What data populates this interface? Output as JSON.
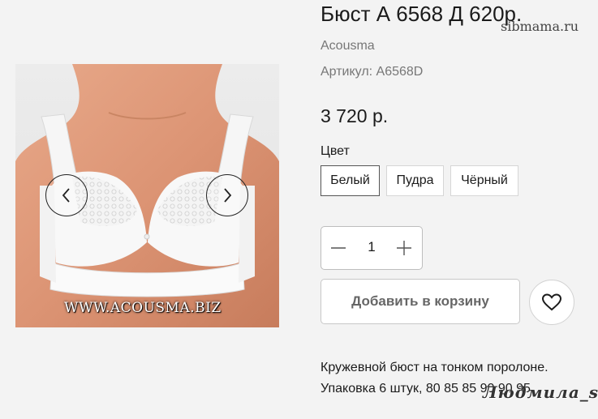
{
  "product": {
    "title": "Бюст А 6568 Д 620р.",
    "brand": "Acousma",
    "sku": "Артикул: А6568D",
    "price": "3 720 р."
  },
  "gallery": {
    "image_watermark": "WWW.ACOUSMA.BIZ",
    "prev_icon": "chevron-left-icon",
    "next_icon": "chevron-right-icon"
  },
  "color": {
    "label": "Цвет",
    "options": [
      "Белый",
      "Пудра",
      "Чёрный"
    ],
    "selected": "Белый"
  },
  "quantity": {
    "value": "1",
    "minus_icon": "minus-icon",
    "plus_icon": "plus-icon"
  },
  "actions": {
    "add_to_cart": "Добавить в корзину",
    "wishlist_icon": "heart-icon"
  },
  "description": {
    "line1": "Кружевной бюст на тонком поролоне.",
    "line2": "Упаковка 6 штук, 80 85 85 90 90 95"
  },
  "watermarks": {
    "site": "sibmama.ru",
    "signature": "Людмила_s"
  }
}
